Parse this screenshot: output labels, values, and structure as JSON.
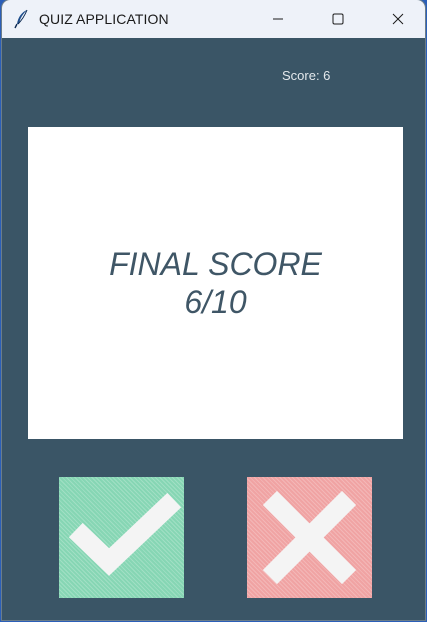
{
  "window": {
    "title": "QUIZ APPLICATION",
    "controls": {
      "minimize_icon": "minimize-icon",
      "maximize_icon": "maximize-icon",
      "close_icon": "close-icon"
    }
  },
  "header": {
    "score_text": "Score: 6"
  },
  "card": {
    "line1": "FINAL SCORE",
    "line2": "6/10"
  },
  "buttons": {
    "true_icon": "checkmark-icon",
    "false_icon": "cross-icon"
  },
  "colors": {
    "background": "#3a5566",
    "card": "#ffffff",
    "card_text": "#3f5666",
    "true_button": "#86d6b4",
    "false_button": "#f0a3a3",
    "titlebar": "#eef2f9"
  }
}
